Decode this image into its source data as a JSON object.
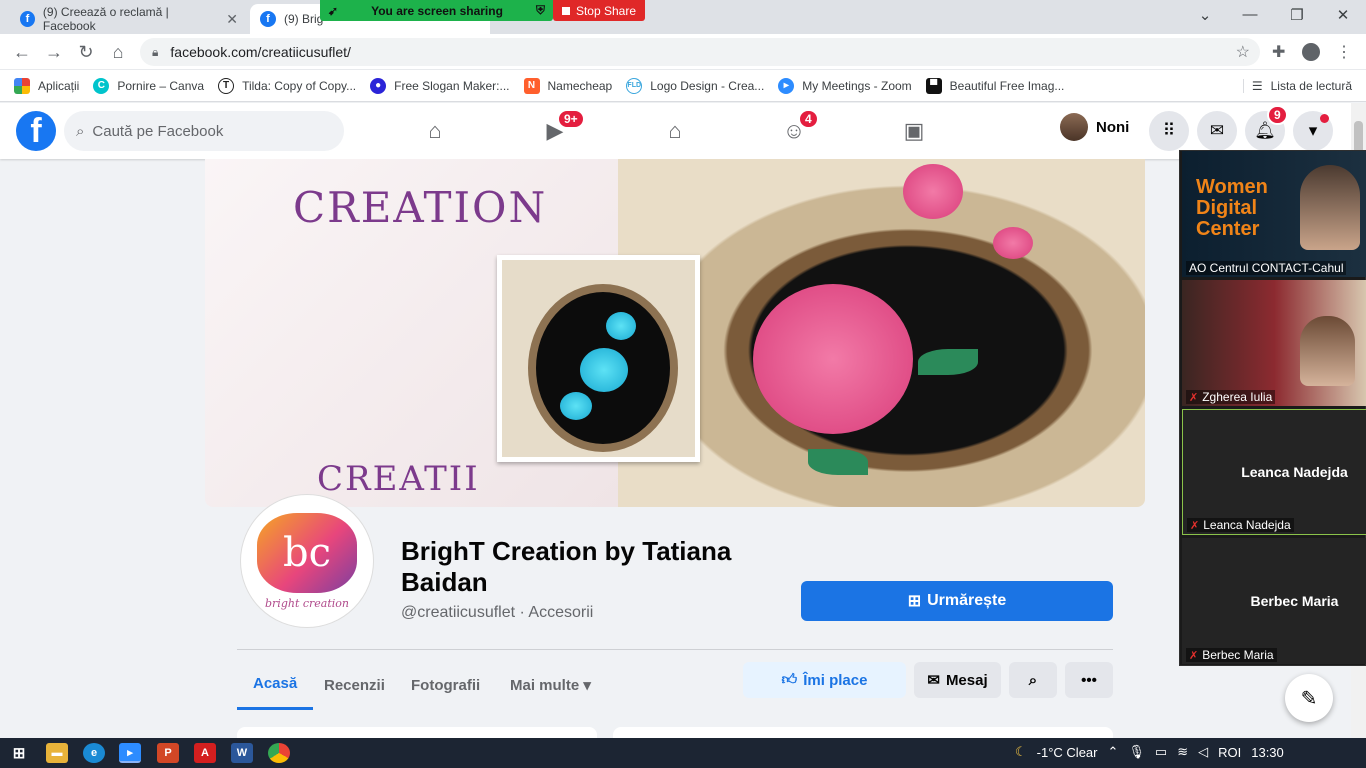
{
  "browser": {
    "tabs": [
      {
        "title": "(9) Creează o reclamă | Facebook",
        "active": false
      },
      {
        "title": "(9) Brig",
        "active": true
      }
    ],
    "url": "facebook.com/creatiicusuflet/",
    "bookmarks": [
      {
        "label": "Aplicații",
        "icon": "apps-grid-icon",
        "color": "#e94235"
      },
      {
        "label": "Pornire – Canva",
        "icon": "canva-icon",
        "color": "#00c4cc"
      },
      {
        "label": "Tilda: Copy of Copy...",
        "icon": "tilda-icon",
        "color": "#222222"
      },
      {
        "label": "Free Slogan Maker:...",
        "icon": "slogan-icon",
        "color": "#2b24d8"
      },
      {
        "label": "Namecheap",
        "icon": "namecheap-icon",
        "color": "#ff5f2d"
      },
      {
        "label": "Logo Design - Crea...",
        "icon": "logo-design-icon",
        "color": "#3aa6dd"
      },
      {
        "label": "My Meetings - Zoom",
        "icon": "zoom-icon",
        "color": "#2d8cff"
      },
      {
        "label": "Beautiful Free Imag...",
        "icon": "unsplash-icon",
        "color": "#111111"
      }
    ],
    "reading_list": "Lista de lectură"
  },
  "screen_share": {
    "status": "You are screen sharing",
    "stop_label": "Stop Share"
  },
  "fb_header": {
    "search_placeholder": "Caută pe Facebook",
    "video_badge": "9+",
    "groups_badge": "4",
    "user_name": "Noni",
    "notifications_badge": "9"
  },
  "cover": {
    "word_top": "CREATION",
    "word_bottom": "CREATII"
  },
  "page": {
    "name": "BrighT Creation by Tatiana Baidan",
    "handle_category": "@creatiicusuflet · Accesorii",
    "follow_label": "Urmărește",
    "logo_letters": "bc",
    "logo_text": "bright creation"
  },
  "page_tabs": [
    {
      "label": "Acasă",
      "active": true
    },
    {
      "label": "Recenzii",
      "active": false
    },
    {
      "label": "Fotografii",
      "active": false
    },
    {
      "label": "Mai multe ▾",
      "active": false
    }
  ],
  "actions": {
    "like_label": "Îmi place",
    "message_label": "Mesaj"
  },
  "zoom": {
    "participants": [
      {
        "name": "AO Centrul CONTACT-Cahul",
        "muted": false
      },
      {
        "name": "Zgherea Iulia",
        "muted": true
      },
      {
        "name": "Leanca Nadejda",
        "muted": true,
        "display": "Leanca Nadejda"
      },
      {
        "name": "Berbec  Maria",
        "muted": true,
        "display": "Berbec  Maria"
      }
    ],
    "banner_text": "Women Digital Center"
  },
  "taskbar": {
    "weather": "-1°C  Clear",
    "lang": "ROI",
    "time": "13:30"
  },
  "colors": {
    "fb_blue": "#1b74e4",
    "badge_red": "#e41e3f",
    "share_green": "#1db24b",
    "stop_red": "#e02828"
  }
}
